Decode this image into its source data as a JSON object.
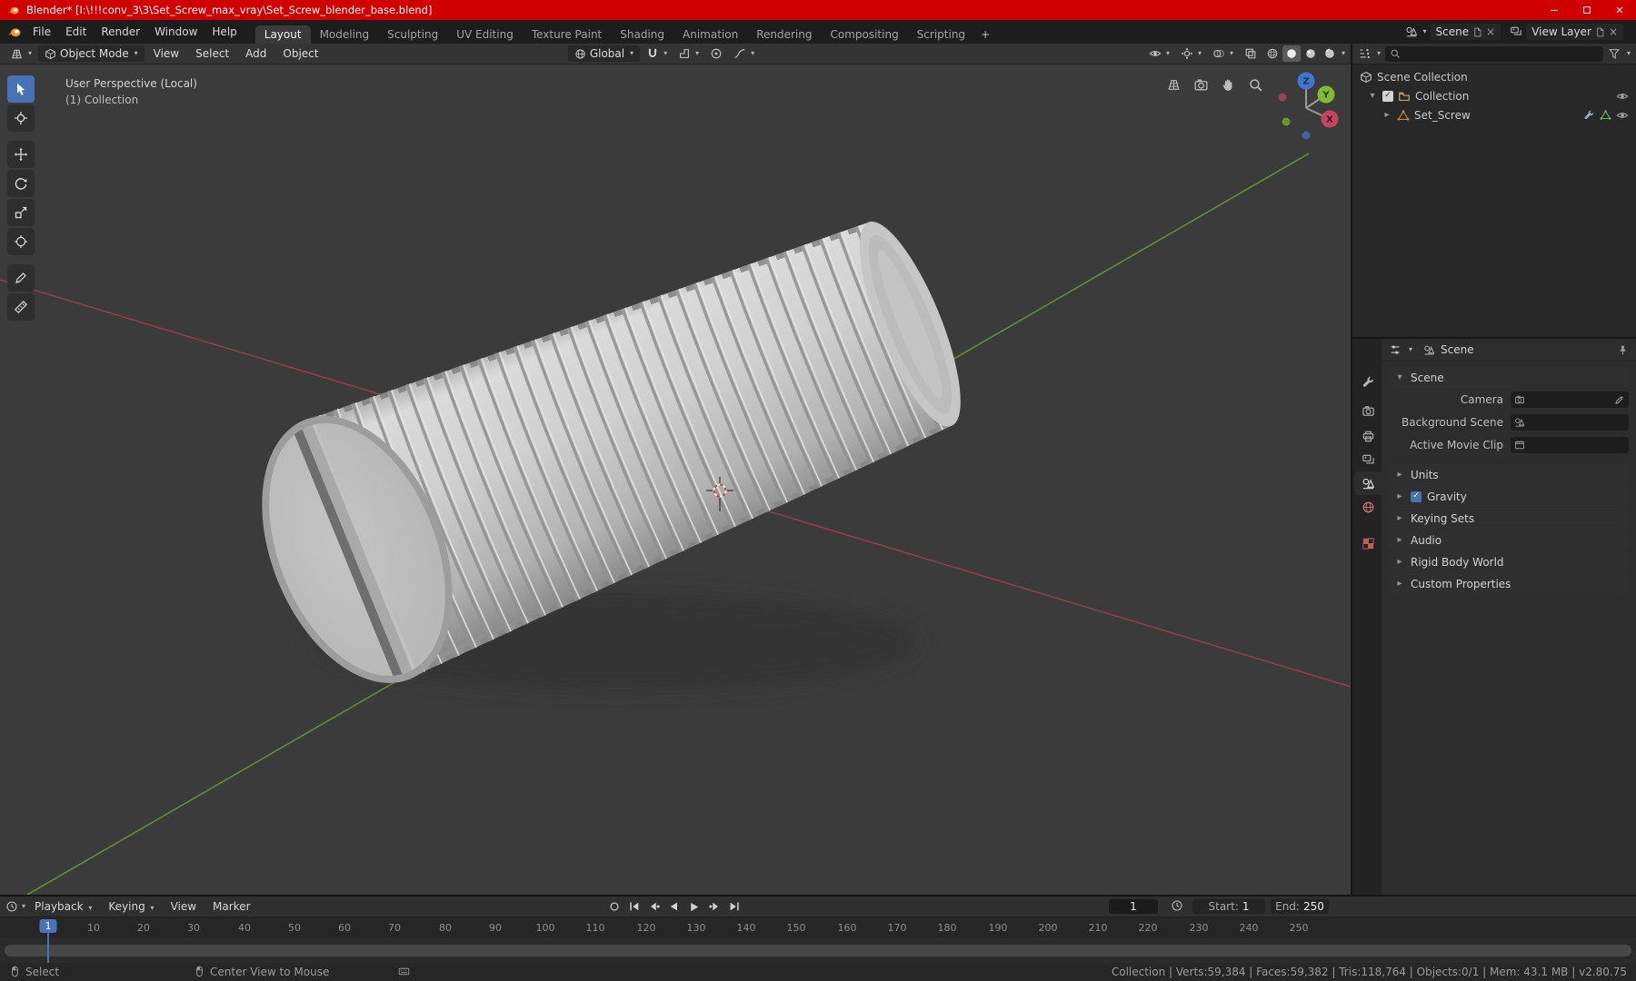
{
  "colors": {
    "titlebar_red": "#d10000",
    "accent_blue": "#4772b3",
    "viewport_bg": "#3b3b3b",
    "axis_x_red": "#8f4049",
    "axis_y_green": "#5f8f33"
  },
  "titlebar": {
    "title": "Blender* [I:\\!!!conv_3\\3\\Set_Screw_max_vray\\Set_Screw_blender_base.blend]"
  },
  "menubar": {
    "menus": [
      "File",
      "Edit",
      "Render",
      "Window",
      "Help"
    ],
    "workspaces": [
      "Layout",
      "Modeling",
      "Sculpting",
      "UV Editing",
      "Texture Paint",
      "Shading",
      "Animation",
      "Rendering",
      "Compositing",
      "Scripting"
    ],
    "active_workspace": "Layout",
    "add_workspace": "+",
    "scene_name": "Scene",
    "view_layer_name": "View Layer"
  },
  "tool_header": {
    "mode": "Object Mode",
    "menus": [
      "View",
      "Select",
      "Add",
      "Object"
    ],
    "orientation": "Global"
  },
  "viewport": {
    "overlay_line1": "User Perspective (Local)",
    "overlay_line2": "(1) Collection",
    "gizmo": {
      "x": "X",
      "y": "Y",
      "z": "Z"
    }
  },
  "outliner": {
    "rows": [
      {
        "label": "Scene Collection"
      },
      {
        "label": "Collection"
      },
      {
        "label": "Set_Screw"
      }
    ]
  },
  "properties": {
    "breadcrumb": "Scene",
    "section_title": "Scene",
    "fields": [
      {
        "label": "Camera"
      },
      {
        "label": "Background Scene"
      },
      {
        "label": "Active Movie Clip"
      }
    ],
    "sections": [
      "Units",
      "Gravity",
      "Keying Sets",
      "Audio",
      "Rigid Body World",
      "Custom Properties"
    ]
  },
  "timeline": {
    "menus": [
      "Playback",
      "Keying",
      "View",
      "Marker"
    ],
    "current_frame": "1",
    "start_label": "Start:",
    "start_value": "1",
    "end_label": "End:",
    "end_value": "250",
    "ticks": [
      "10",
      "20",
      "30",
      "40",
      "50",
      "60",
      "70",
      "80",
      "90",
      "100",
      "110",
      "120",
      "130",
      "140",
      "150",
      "160",
      "170",
      "180",
      "190",
      "200",
      "210",
      "220",
      "230",
      "240",
      "250"
    ]
  },
  "statusbar": {
    "items": [
      "Select",
      "Center View to Mouse"
    ],
    "stats": "Collection | Verts:59,384 | Faces:59,382 | Tris:118,764 | Objects:0/1 | Mem: 43.1 MB | v2.80.75"
  }
}
